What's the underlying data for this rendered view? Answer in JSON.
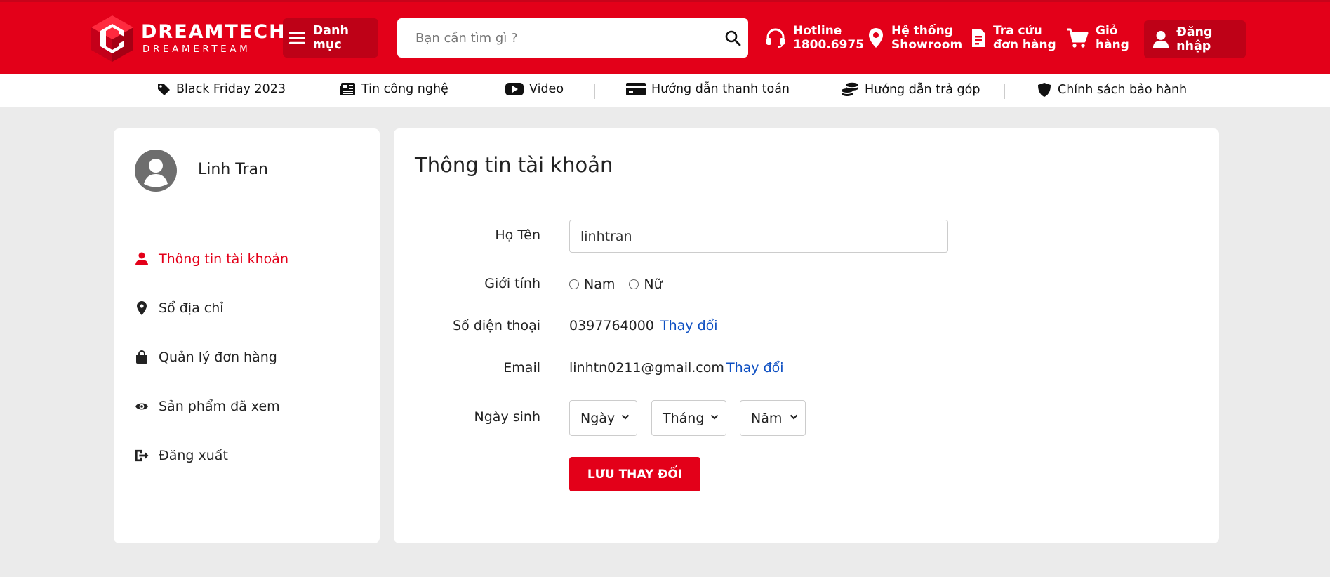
{
  "header": {
    "logo_title": "DREAMTECH",
    "logo_subtitle": "DREAMERTEAM",
    "category_label": "Danh mục",
    "search_placeholder": "Bạn cần tìm gì ?",
    "hotline_line1": "Hotline",
    "hotline_line2": "1800.6975",
    "showroom_line1": "Hệ thống",
    "showroom_line2": "Showroom",
    "order_lookup_line1": "Tra cứu",
    "order_lookup_line2": "đơn hàng",
    "cart_line1": "Giỏ",
    "cart_line2": "hàng",
    "login_label": "Đăng nhập",
    "brand_color": "#e30019"
  },
  "subnav": [
    {
      "label": "Black Friday 2023",
      "icon": "tag-icon"
    },
    {
      "label": "Tin công nghệ",
      "icon": "newspaper-icon"
    },
    {
      "label": "Video",
      "icon": "youtube-icon"
    },
    {
      "label": "Hướng dẫn thanh toán",
      "icon": "credit-card-icon"
    },
    {
      "label": "Hướng dẫn trả góp",
      "icon": "coins-icon"
    },
    {
      "label": "Chính sách bảo hành",
      "icon": "shield-icon"
    }
  ],
  "sidebar": {
    "user_name": "Linh Tran",
    "items": [
      {
        "label": "Thông tin tài khoản",
        "icon": "user-icon",
        "active": true
      },
      {
        "label": "Sổ địa chỉ",
        "icon": "map-pin-icon"
      },
      {
        "label": "Quản lý đơn hàng",
        "icon": "shopping-bag-icon"
      },
      {
        "label": "Sản phẩm đã xem",
        "icon": "eye-icon"
      },
      {
        "label": "Đăng xuất",
        "icon": "logout-icon"
      }
    ]
  },
  "account": {
    "title": "Thông tin tài khoản",
    "name_label": "Họ Tên",
    "name_value": "linhtran",
    "gender_label": "Giới tính",
    "gender_options": [
      "Nam",
      "Nữ"
    ],
    "phone_label": "Số điện thoại",
    "phone_value": "0397764000",
    "email_label": "Email",
    "email_value": "linhtn0211@gmail.com",
    "change_link": "Thay đổi",
    "birthday_label": "Ngày sinh",
    "day_placeholder": "Ngày",
    "month_placeholder": "Tháng",
    "year_placeholder": "Năm",
    "save_label": "LƯU THAY ĐỔI"
  }
}
